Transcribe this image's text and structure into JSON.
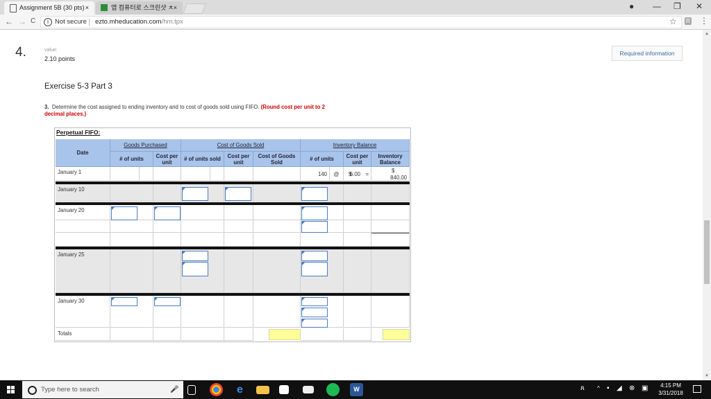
{
  "browser": {
    "tabs": [
      {
        "title": "Assignment 5B (30 pts)",
        "close": "×"
      },
      {
        "title": "앱 컴퓨터로 스크린샷 ㅊ",
        "close": "×"
      }
    ],
    "window_controls": {
      "profile": "●",
      "minimize": "—",
      "restore": "❐",
      "close": "✕"
    },
    "nav": {
      "back": "←",
      "forward": "→",
      "reload": "C"
    },
    "address": {
      "security_icon": "i",
      "security": "Not secure",
      "host": "ezto.mheducation.com",
      "path": "/hm.tpx"
    },
    "star": "☆",
    "extension": "R",
    "menu": "⋮"
  },
  "question": {
    "number": "4.",
    "value_label": "value:",
    "points": "2.10 points",
    "required_button": "Required information",
    "exercise_title": "Exercise 5-3 Part 3",
    "instruction_num": "3.",
    "instruction_text": "Determine the cost assigned to ending inventory and to cost of goods sold using FIFO.",
    "instruction_note": "(Round cost per unit to 2 decimal places.)"
  },
  "worksheet": {
    "title": "Perpetual FIFO:",
    "groups": [
      "Goods Purchased",
      "Cost of Goods Sold",
      "Inventory Balance"
    ],
    "headers": {
      "date": "Date",
      "gp_units": "# of units",
      "gp_cost": "Cost per unit",
      "cogs_units": "# of units sold",
      "cogs_cost": "Cost per unit",
      "cogs_total": "Cost of Goods Sold",
      "inv_units": "# of units",
      "inv_cost": "Cost per unit",
      "inv_balance": "Inventory Balance"
    },
    "dates": [
      "January 1",
      "January 10",
      "January 20",
      "January 25",
      "January 30"
    ],
    "totals_label": "Totals",
    "jan1": {
      "units": "140",
      "at": "@",
      "dollar": "$",
      "cost": "6.00",
      "eq": "=",
      "balance_dollar": "$",
      "balance": "840.00"
    }
  },
  "taskbar": {
    "search_placeholder": "Type here to search",
    "mic": "🎤",
    "time": "4:15 PM",
    "date": "3/31/2018",
    "tray_icons": [
      "person-icon",
      "chevron-up-icon",
      "network-icon",
      "volume-icon",
      "pen-icon",
      "language-icon"
    ],
    "apps": [
      "task-view-icon",
      "chrome-icon",
      "edge-icon",
      "file-explorer-icon",
      "store-icon",
      "mail-icon",
      "spotify-icon",
      "word-icon"
    ],
    "colors": {
      "taskbar": "#101010",
      "accent": "#3b6aa6",
      "header": "#a9c4ea",
      "input_border": "#4a7cc0",
      "highlight": "#ffff99"
    }
  }
}
